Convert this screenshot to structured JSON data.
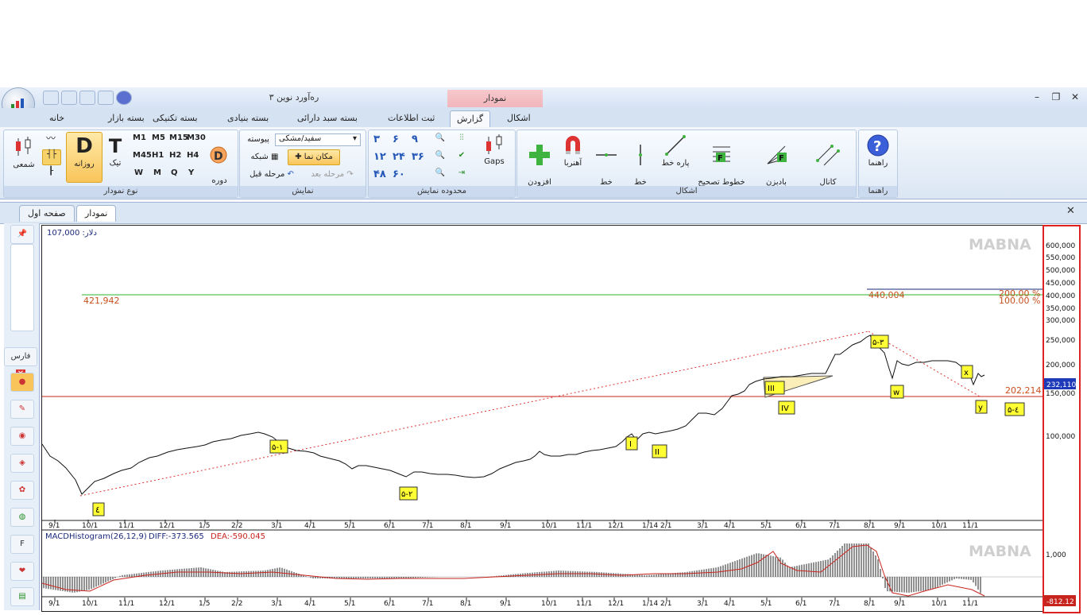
{
  "app": {
    "title": "ره‌آورد نوین ۳",
    "context_tab": "نمودار"
  },
  "ribbon_tabs": [
    "خانه",
    "بسته بازار",
    "بسته تکنیکی",
    "بسته بنیادی",
    "بسته سبد دارائی",
    "ثبت اطلاعات",
    "گزارش",
    "اشکال"
  ],
  "ribbon": {
    "groups": {
      "chart_type": "نوع نمودار",
      "display": "نمایش",
      "display_range": "محدوده نمایش",
      "shapes": "اشکال",
      "help": "راهنما"
    },
    "chart_type": {
      "candle": "شمعی",
      "daily": "روزانه",
      "tick": "تیک",
      "period": "دوره\nدلخواه"
    },
    "periods": [
      "M1",
      "M5",
      "M15",
      "M30",
      "M45",
      "H1",
      "H2",
      "H4",
      "W",
      "M",
      "Q",
      "Y"
    ],
    "display": {
      "theme": "سفید/مشکی",
      "continuous": "پیوسته",
      "cursor": "مکان نما",
      "grid": "شبکه",
      "next": "مرحله بعد",
      "prev": "مرحله قبل"
    },
    "range": {
      "digits": [
        "۳",
        "۶",
        "۹",
        "۱۲",
        "۲۴",
        "۳۶",
        "۴۸",
        "۶۰"
      ],
      "gaps": "Gaps"
    },
    "shapes": {
      "add_indicator": "افزودن\nاندیکاتور",
      "magnet": "آهنربا",
      "hline": "خط\nافقی",
      "vline": "خط\nعمودی",
      "segment": "پاره خط",
      "fib_fix": "خطوط تصحیح\nفیبوناچی",
      "fib_fan": "بادبزن\nفیبوناچی",
      "quadrant": "کانال\nکوادرانت"
    },
    "help": {
      "guide": "راهنما"
    }
  },
  "doc_tabs": {
    "first": "صفحه اول",
    "chart": "نمودار"
  },
  "sidebar": {
    "buy": "فارس"
  },
  "chart": {
    "price_label": "دلار: 107,000",
    "watermark": "MABNA",
    "hlines": [
      {
        "value": 421942,
        "label": "421,942",
        "color": "#2db52d"
      },
      {
        "value": 202214,
        "label": "202,214",
        "color": "#c8241e"
      },
      {
        "value": 440004,
        "label": "440,004",
        "color": "#1b2a7a"
      }
    ],
    "fib_labels": [
      "200.00 %",
      "100.00 %"
    ],
    "current_price": "232,110",
    "y_ticks": [
      "600,000",
      "550,000",
      "500,000",
      "450,000",
      "400,000",
      "350,000",
      "300,000",
      "250,000",
      "200,000",
      "150,000",
      "100,000"
    ],
    "x_ticks": [
      "9/1",
      "10/1",
      "11/1",
      "12/1",
      "1/5",
      "2/2",
      "3/1",
      "4/1",
      "5/1",
      "6/1",
      "7/1",
      "8/1",
      "9/1",
      "10/1",
      "11/1",
      "12/1",
      "1/14",
      "2/1",
      "3/1",
      "4/1",
      "5/1",
      "6/1",
      "7/1",
      "8/1",
      "9/1",
      "10/1",
      "11/1"
    ],
    "wave_labels": [
      "٤",
      "۵-۱",
      "۵-۲",
      "I",
      "II",
      "III",
      "IV",
      "۵-۳",
      "w",
      "x",
      "y",
      "۵-٤"
    ]
  },
  "macd": {
    "title": "MACDHistogram(26,12,9)",
    "diff": "DIFF:-373.565",
    "dea": "DEA:-590.045",
    "y_tick": "1,000",
    "current": "-812.12",
    "watermark": "MABNA"
  }
}
